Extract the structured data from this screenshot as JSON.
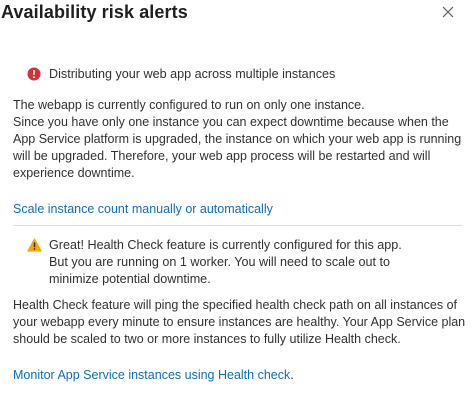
{
  "panel": {
    "title": "Availability risk alerts",
    "close_label": "Close"
  },
  "error_alert": {
    "icon": "error-circle-icon",
    "color": "#d13438",
    "text": "Distributing your web app across multiple instances"
  },
  "paragraph_1": {
    "lines": [
      "The webapp is currently configured to run on only one instance.",
      "Since you have only one instance you can expect downtime because when the",
      "App Service platform is upgraded, the instance on which your web app is running",
      "will be upgraded. Therefore, your web app process will be restarted and will",
      "experience downtime."
    ]
  },
  "scale_link": {
    "text": "Scale instance count manually or automatically"
  },
  "warning_alert": {
    "icon": "warning-triangle-icon",
    "color": "#f7a600",
    "lines": [
      "Great! Health Check feature is currently configured for this app.",
      "But you are running on 1 worker. You will need to scale out to",
      "minimize potential downtime."
    ]
  },
  "paragraph_2": {
    "lines": [
      "Health Check feature will ping the specified health check path on all instances of",
      "your webapp every minute to ensure instances are healthy. Your App Service plan",
      "should be scaled to two or more instances to fully utilize Health check."
    ]
  },
  "monitor_link": {
    "text": "Monitor App Service instances using Health check",
    "suffix": "."
  },
  "colors": {
    "link": "#0f6cbd",
    "text": "#323130",
    "divider": "#e1dfdd"
  }
}
